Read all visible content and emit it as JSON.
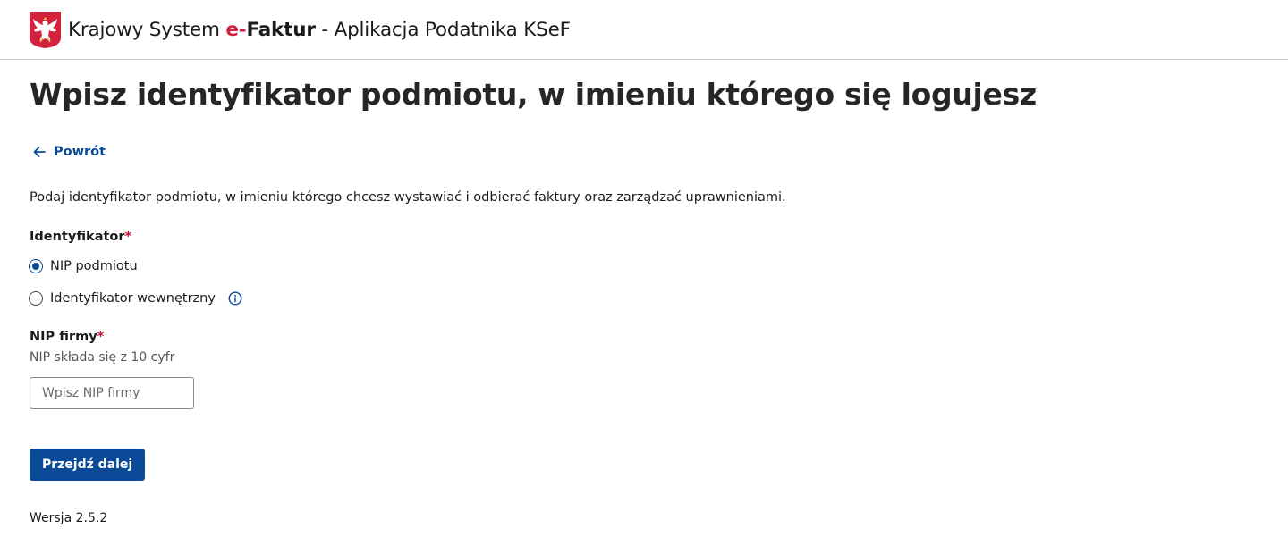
{
  "header": {
    "prefix": "Krajowy System ",
    "brand_e": "e-",
    "brand_rest": "Faktur",
    "suffix": " - Aplikacja Podatnika KSeF",
    "emblem_icon": "polish-eagle-emblem",
    "emblem_color": "#d4213d"
  },
  "page": {
    "title": "Wpisz identyfikator podmiotu, w imieniu którego się logujesz",
    "back_label": "Powrót",
    "description": "Podaj identyfikator podmiotu, w imieniu którego chcesz wystawiać i odbierać faktury oraz zarządzać uprawnieniami."
  },
  "identifier": {
    "label": "Identyfikator",
    "required_mark": "*",
    "options": [
      {
        "label": "NIP podmiotu",
        "checked": true
      },
      {
        "label": "Identyfikator wewnętrzny",
        "checked": false,
        "icon": "info-icon"
      }
    ]
  },
  "nip": {
    "label": "NIP firmy",
    "required_mark": "*",
    "hint": "NIP składa się z 10 cyfr",
    "placeholder": "Wpisz NIP firmy",
    "value": ""
  },
  "actions": {
    "next_label": "Przejdź dalej"
  },
  "footer": {
    "version": "Wersja 2.5.2"
  },
  "colors": {
    "primary": "#0b4a97",
    "required": "#c8102e",
    "brand_red": "#d4213d"
  }
}
